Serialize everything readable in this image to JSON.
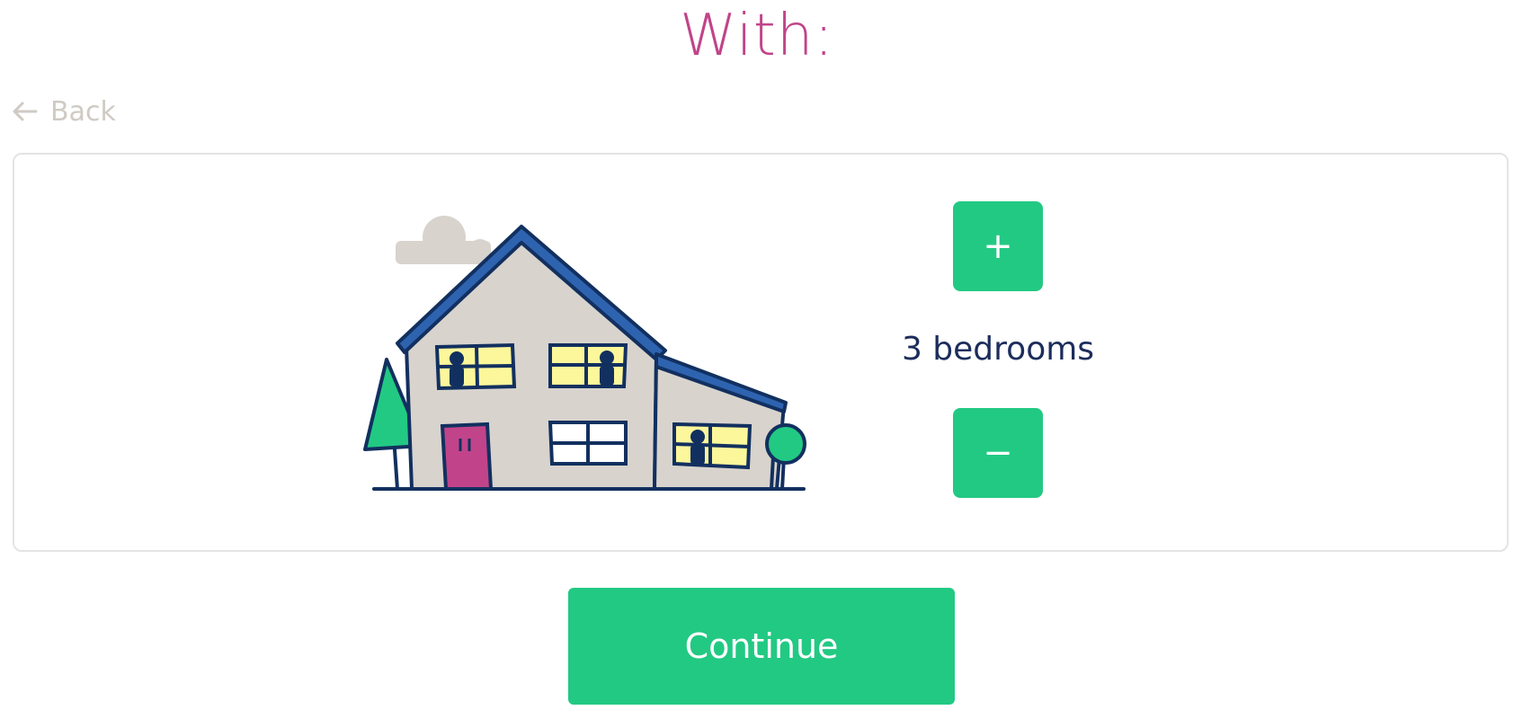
{
  "header": {
    "title": "With:"
  },
  "navigation": {
    "back_label": "Back"
  },
  "bedrooms": {
    "increment_label": "+",
    "decrement_label": "−",
    "value_label": "3 bedrooms"
  },
  "footer": {
    "continue_label": "Continue"
  },
  "colors": {
    "accent_green": "#22c983",
    "title_magenta": "#c1448a",
    "text_navy": "#1c2d5c",
    "muted_gray": "#cfcac3"
  },
  "icons": {
    "back": "arrow-left-icon",
    "illustration": "house-illustration"
  }
}
